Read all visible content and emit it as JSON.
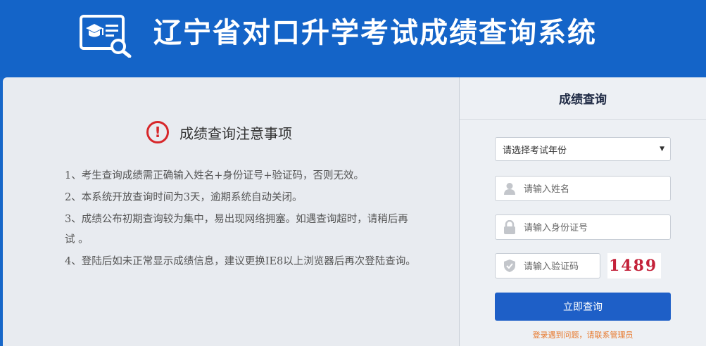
{
  "header": {
    "title": "辽宁省对口升学考试成绩查询系统",
    "logo_icon": "graduation-cap-search-icon"
  },
  "notice": {
    "title": "成绩查询注意事项",
    "icon": "exclamation-circle-icon",
    "items": [
      "1、考生查询成绩需正确输入姓名+身份证号+验证码，否则无效。",
      "2、本系统开放查询时间为3天，逾期系统自动关闭。",
      "3、成绩公布初期查询较为集中，易出现网络拥塞。如遇查询超时，请稍后再试 。",
      "4、登陆后如未正常显示成绩信息，建议更换IE8以上浏览器后再次登陆查询。"
    ]
  },
  "login": {
    "title": "成绩查询",
    "year_select": "请选择考试年份",
    "name_placeholder": "请输入姓名",
    "id_placeholder": "请输入身份证号",
    "code_placeholder": "请输入验证码",
    "captcha": "1489",
    "submit_label": "立即查询",
    "help_text": "登录遇到问题，请联系管理员"
  },
  "colors": {
    "header_bg": "#1464c8",
    "warning": "#d7262a",
    "button": "#1e5fc7",
    "help": "#e87a2e"
  }
}
